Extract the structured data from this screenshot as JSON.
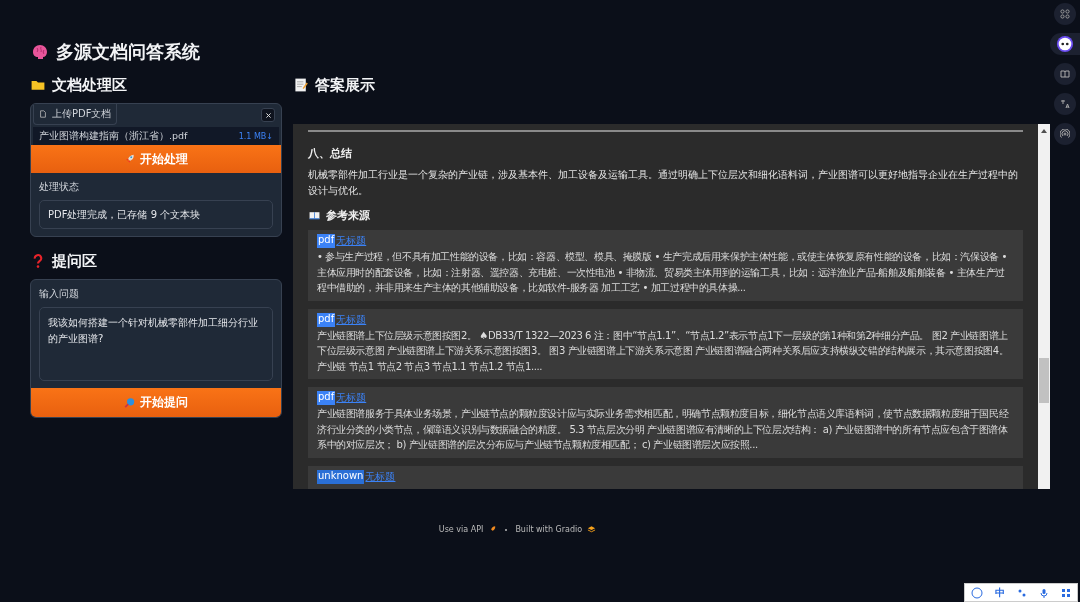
{
  "app": {
    "title": "多源文档问答系统"
  },
  "document_section": {
    "heading": "文档处理区",
    "upload": {
      "tab_label": "上传PDF文档",
      "file_name": "产业图谱构建指南（浙江省）.pdf",
      "file_size": "1.1 MB↓"
    },
    "process_button": "开始处理",
    "status": {
      "label": "处理状态",
      "value": "PDF处理完成，已存储 9 个文本块"
    }
  },
  "question_section": {
    "heading": "提问区",
    "input": {
      "label": "输入问题",
      "value": "我该如何搭建一个针对机械零部件加工细分行业的产业图谱?"
    },
    "ask_button": "开始提问"
  },
  "answer_section": {
    "heading": "答案展示",
    "summary_heading": "八、总结",
    "summary_text": "机械零部件加工行业是一个复杂的产业链，涉及基本件、加工设备及运输工具。通过明确上下位层次和细化语料词，产业图谱可以更好地指导企业在生产过程中的设计与优化。",
    "sources_heading": "参考来源",
    "sources": [
      {
        "type": "pdf",
        "title": "无标题",
        "text": "• 参与生产过程，但不具有加工性能的设备，比如：容器、模型、模具、掩膜版 • 生产完成后用来保护主体性能，或使主体恢复原有性能的设备，比如：汽保设备 • 主体应用时的配套设备，比如：注射器、遥控器、充电桩、一次性电池 • 非物流、贸易类主体用到的运输工具，比如：远洋渔业产品-船舶及船舶装备 • 主体生产过程中借助的，并非用来生产主体的其他辅助设备，比如软件-服务器 加工工艺 • 加工过程中的具体操..."
      },
      {
        "type": "pdf",
        "title": "无标题",
        "text": "产业链图谱上下位层级示意图按图2。 ♠DB33/T 1322—2023 6 注：图中“节点1.1”、“节点1.2”表示节点1下一层级的第1种和第2种细分产品。 图2 产业链图谱上下位层级示意图 产业链图谱上下游关系示意图按图3。 图3 产业链图谱上下游关系示意图 产业链图谱融合两种关系后应支持横纵交错的结构展示，其示意图按图4。产业链 节点1 节点2 节点3 节点1.1 节点1.2 节点1...."
      },
      {
        "type": "pdf",
        "title": "无标题",
        "text": "产业链图谱服务于具体业务场景，产业链节点的颗粒度设计应与实际业务需求相匹配，明确节点颗粒度目标，细化节点语义库语料词，使节点数据颗粒度细于国民经济行业分类的小类节点，保障语义识别与数据融合的精度。 5.3 节点层次分明 产业链图谱应有清晰的上下位层次结构： a) 产业链图谱中的所有节点应包含于图谱体系中的对应层次； b) 产业链图谱的层次分布应与产业链节点颗粒度相匹配； c) 产业链图谱层次应按照..."
      },
      {
        "type": "unknown",
        "title": "无标题"
      }
    ]
  },
  "footer": {
    "api_link": "Use via API",
    "built_with": "Built with Gradio"
  },
  "ime_bar": {
    "mode": "中"
  }
}
